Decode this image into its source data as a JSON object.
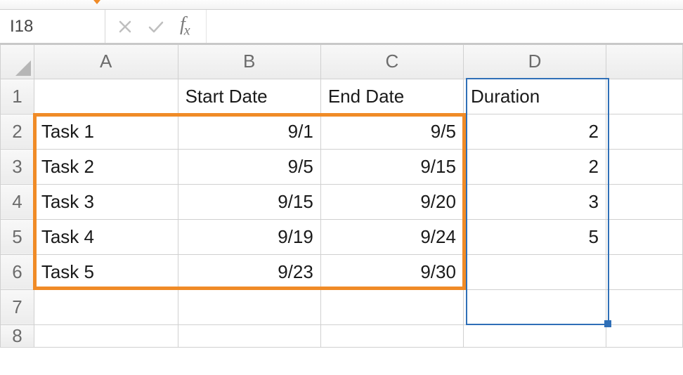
{
  "namebox": {
    "value": "I18"
  },
  "formula_bar": {
    "value": ""
  },
  "columns": [
    "A",
    "B",
    "C",
    "D"
  ],
  "row_numbers": [
    "1",
    "2",
    "3",
    "4",
    "5",
    "6",
    "7",
    "8"
  ],
  "headers": {
    "A": "",
    "B": "Start Date",
    "C": "End Date",
    "D": "Duration"
  },
  "rows": [
    {
      "task": "Task 1",
      "start": "9/1",
      "end": "9/5",
      "duration": "2"
    },
    {
      "task": "Task 2",
      "start": "9/5",
      "end": "9/15",
      "duration": "2"
    },
    {
      "task": "Task 3",
      "start": "9/15",
      "end": "9/20",
      "duration": "3"
    },
    {
      "task": "Task 4",
      "start": "9/19",
      "end": "9/24",
      "duration": "5"
    },
    {
      "task": "Task 5",
      "start": "9/23",
      "end": "9/30",
      "duration": ""
    }
  ],
  "fx_label": "fx"
}
